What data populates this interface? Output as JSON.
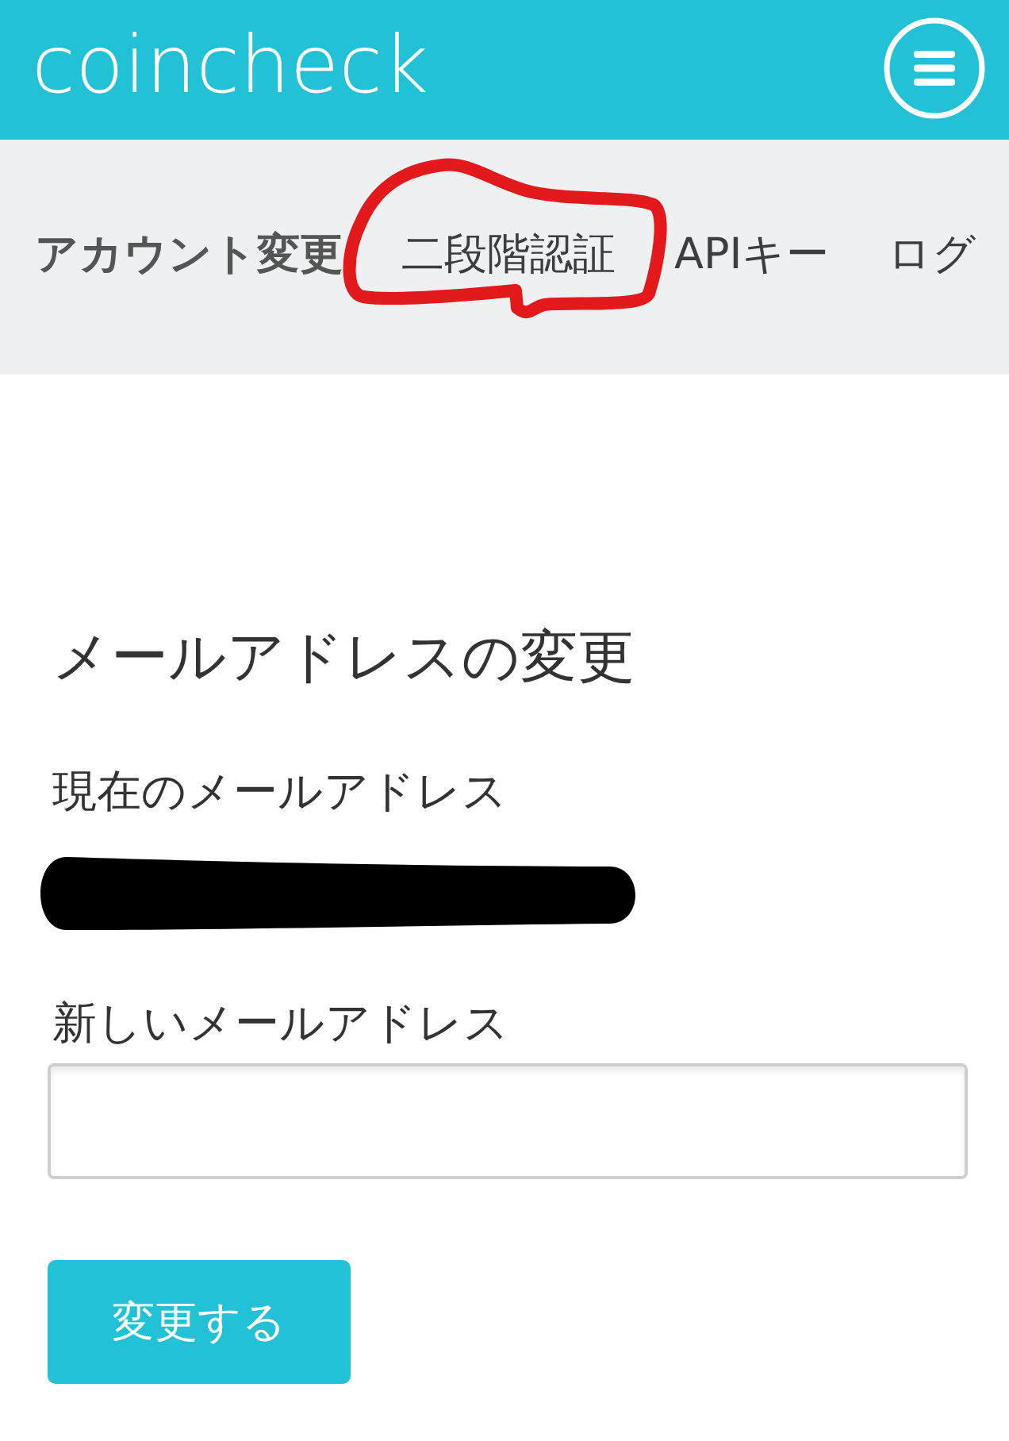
{
  "header": {
    "logo": "coincheck"
  },
  "tabs": [
    {
      "label": "アカウント変更",
      "selected": true,
      "circled": false
    },
    {
      "label": "二段階認証",
      "selected": false,
      "circled": true
    },
    {
      "label": "APIキー",
      "selected": false,
      "circled": false
    },
    {
      "label": "ログ",
      "selected": false,
      "circled": false
    }
  ],
  "email_form": {
    "heading": "メールアドレスの変更",
    "current_label": "現在のメールアドレス",
    "current_redacted": true,
    "new_label": "新しいメールアドレス",
    "submit_button": "変更する"
  }
}
